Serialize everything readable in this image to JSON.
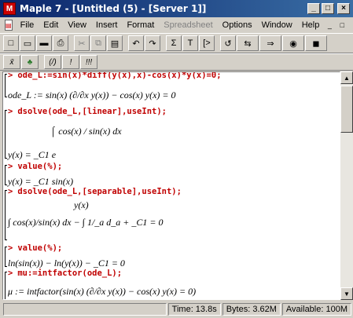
{
  "window": {
    "title": "Maple 7 - [Untitled (5) - [Server 1]]",
    "app_icon_glyph": "M",
    "min_glyph": "_",
    "max_glyph": "□",
    "close_glyph": "×"
  },
  "menu": {
    "items": [
      "File",
      "Edit",
      "View",
      "Insert",
      "Format",
      "Spreadsheet",
      "Options",
      "Window",
      "Help"
    ],
    "disabled_index": 5,
    "right_glyphs": [
      "_",
      "□",
      "×"
    ]
  },
  "toolbar1": {
    "buttons": [
      "new",
      "open",
      "save",
      "print",
      "cut",
      "copy",
      "paste",
      "undo",
      "redo",
      "sum",
      "T",
      "[>",
      "↺",
      "↔",
      "→",
      "◎",
      "■"
    ],
    "glyphs": [
      "□",
      "▭",
      "▬",
      "⎙",
      "✂",
      "⧉",
      "▤",
      "↶",
      "↷",
      "Σ",
      "T",
      "[>",
      "↺",
      "⇆",
      "⇒",
      "◉",
      "◼"
    ]
  },
  "toolbar2": {
    "glyphs": [
      "x̄",
      "♣",
      "(/)",
      "!",
      "!!!"
    ]
  },
  "worksheet": {
    "lines": [
      {
        "type": "cmd",
        "text": "ode_L:=sin(x)*diff(y(x),x)-cos(x)*y(x)=0;"
      },
      {
        "type": "out",
        "text": "ode_L := sin(x) (∂/∂x y(x)) − cos(x) y(x) = 0"
      },
      {
        "type": "cmd",
        "text": "dsolve(ode_L,[linear],useInt);"
      },
      {
        "type": "out",
        "text": "⌠ cos(x) / sin(x) dx"
      },
      {
        "type": "out",
        "text": "y(x) = _C1 e"
      },
      {
        "type": "cmd",
        "text": "value(%);"
      },
      {
        "type": "out",
        "text": "y(x) = _C1 sin(x)"
      },
      {
        "type": "cmd",
        "text": "dsolve(ode_L,[separable],useInt);"
      },
      {
        "type": "out",
        "text": "y(x)"
      },
      {
        "type": "out",
        "text": "∫ cos(x)/sin(x) dx − ∫ 1/_a d_a + _C1 = 0"
      },
      {
        "type": "cmd",
        "text": "value(%);"
      },
      {
        "type": "out",
        "text": "ln(sin(x)) − ln(y(x)) − _C1 = 0"
      },
      {
        "type": "cmd",
        "text": "mu:=intfactor(ode_L);"
      },
      {
        "type": "out",
        "text": "μ := intfactor(sin(x) (∂/∂x y(x)) − cos(x) y(x) = 0)"
      }
    ],
    "prompt": ">"
  },
  "status": {
    "time": "Time: 13.8s",
    "bytes": "Bytes: 3.62M",
    "available": "Available: 100M"
  },
  "scroll": {
    "up": "▲",
    "down": "▼"
  }
}
